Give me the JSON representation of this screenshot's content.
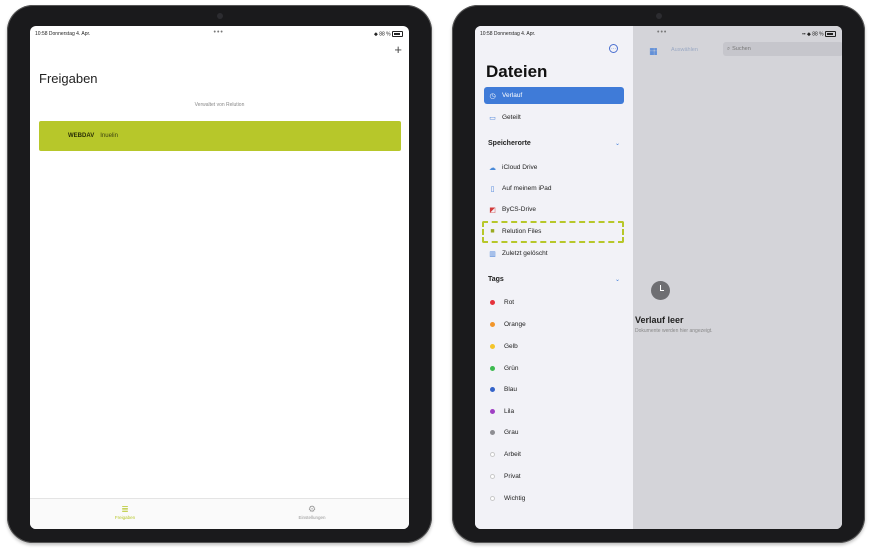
{
  "left_app": {
    "status": {
      "time": "10:58  Donnerstag 4. Apr.",
      "dots": "•••",
      "right": "◆ 88 %"
    },
    "add_label": "+",
    "title": "Freigaben",
    "caption": "Verwaltet von Relution",
    "share": {
      "name": "WEBDAV",
      "subtitle": "Inuelin"
    },
    "tabs": [
      {
        "icon": "≣",
        "label": "Freigaben"
      },
      {
        "icon": "⚙",
        "label": "Einstellungen"
      }
    ]
  },
  "right_app": {
    "status": {
      "time": "10:58  Donnerstag 4. Apr.",
      "dots": "•••",
      "right": "••  ◆ 88 %"
    },
    "menu_label": "···",
    "title": "Dateien",
    "items": [
      {
        "label": "Verlauf"
      },
      {
        "label": "Geteilt"
      }
    ],
    "storage": {
      "header": "Speicherorte",
      "items": [
        {
          "label": "iCloud Drive"
        },
        {
          "label": "Auf meinem iPad"
        },
        {
          "label": "ByCS-Drive"
        },
        {
          "label": "Relution Files"
        },
        {
          "label": "Zuletzt gelöscht"
        }
      ]
    },
    "tags": {
      "header": "Tags",
      "items": [
        {
          "label": "Rot",
          "color": "#e5323b"
        },
        {
          "label": "Orange",
          "color": "#f2962b"
        },
        {
          "label": "Gelb",
          "color": "#f4c52a"
        },
        {
          "label": "Grün",
          "color": "#3cba4f"
        },
        {
          "label": "Blau",
          "color": "#3564c9"
        },
        {
          "label": "Lila",
          "color": "#a040c4"
        },
        {
          "label": "Grau",
          "color": "#8e8e93"
        },
        {
          "label": "Arbeit",
          "color": ""
        },
        {
          "label": "Privat",
          "color": ""
        },
        {
          "label": "Wichtig",
          "color": ""
        }
      ]
    },
    "toolbar": {
      "select_label": "Auswählen",
      "search_placeholder": "Suchen"
    },
    "empty_state": {
      "title": "Verlauf leer",
      "subtitle": "Dokumente werden hier angezeigt."
    },
    "colors": {
      "accent": "#3f7bd8",
      "highlight": "#b7c72a"
    }
  }
}
